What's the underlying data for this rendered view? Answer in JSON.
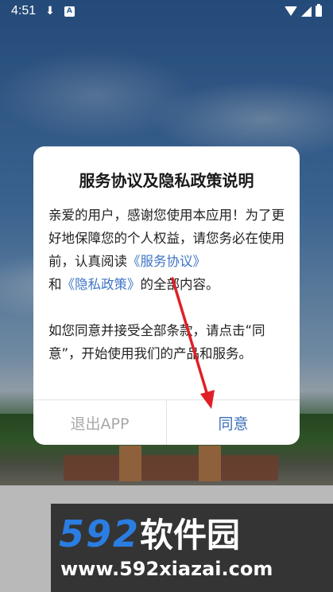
{
  "status_bar": {
    "time": "4:51",
    "download_glyph": "⬇",
    "a_badge": "A",
    "icons": [
      "download-icon",
      "a-notification-icon",
      "wifi-icon",
      "signal-icon",
      "battery-icon"
    ]
  },
  "dialog": {
    "title": "服务协议及隐私政策说明",
    "para1_prefix": "亲爱的用户，感谢您使用本应用！为了更好地保障您的个人权益，请您务必在使用前，认真阅读",
    "link_service": "《服务协议》",
    "para1_and": "和",
    "link_privacy": "《隐私政策》",
    "para1_suffix": "的全部内容。",
    "para2": "如您同意并接受全部条款，请点击“同意”，开始使用我们的产品和服务。",
    "exit_label": "退出APP",
    "agree_label": "同意"
  },
  "watermark": {
    "logo_digits": "592",
    "logo_cn": "软件园",
    "url": "www.592xiazai.com"
  },
  "colors": {
    "link": "#3d74c4",
    "agree": "#3d6fb8",
    "exit": "#a8a8a8",
    "arrow": "#e01f26"
  }
}
